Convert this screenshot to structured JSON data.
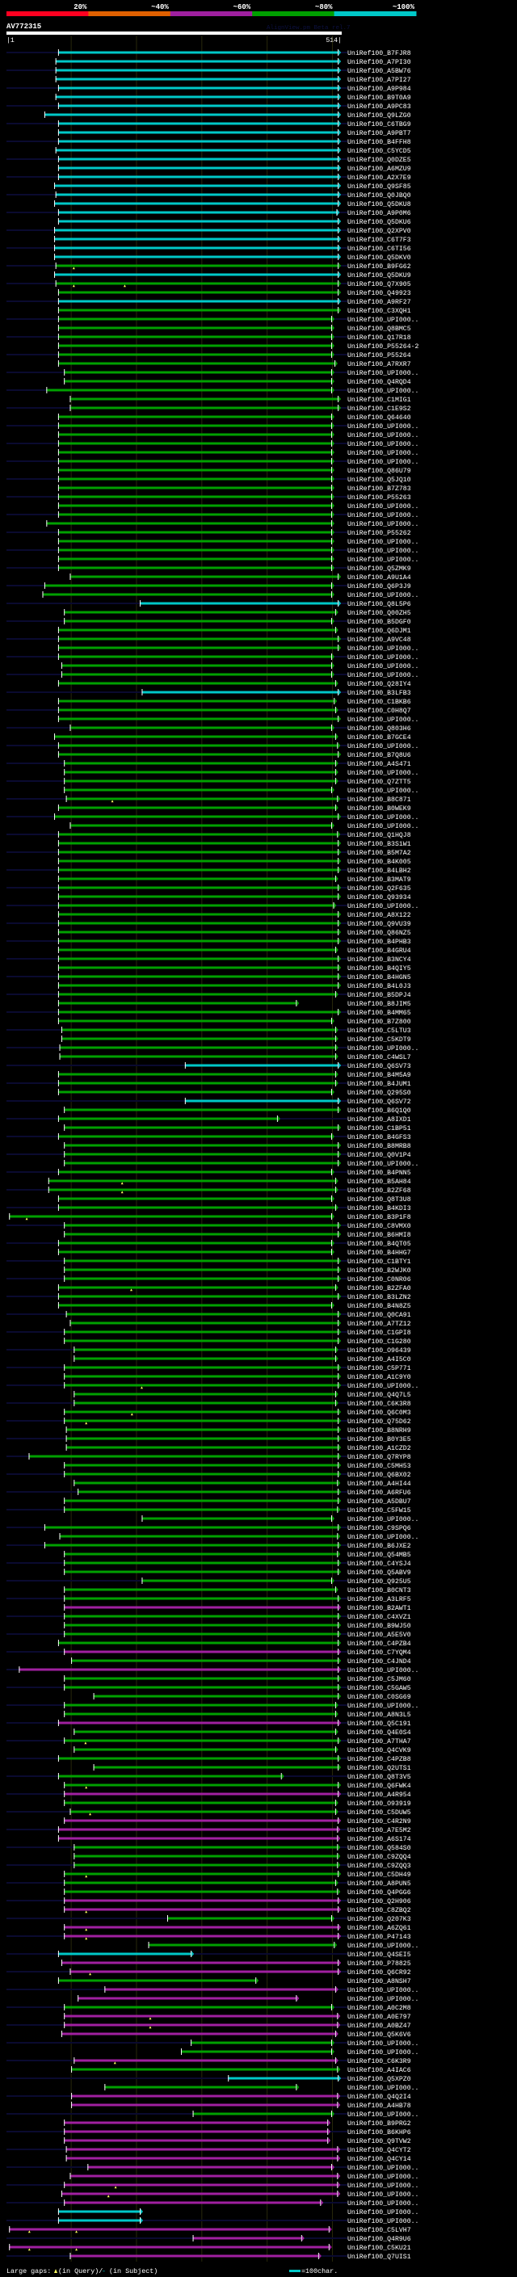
{
  "legend": {
    "segments": [
      {
        "label": "20%",
        "color": "#ff0020"
      },
      {
        "label": "~40%",
        "color": "#e06000"
      },
      {
        "label": "~60%",
        "color": "#a020a0"
      },
      {
        "label": "~80%",
        "color": "#00a000"
      },
      {
        "label": "~100%",
        "color": "#00c8c8"
      }
    ]
  },
  "query": {
    "name": "AV772315",
    "watermark": "AlignView.pm Beta rel.7",
    "start_label": "|1",
    "end_label": "514|",
    "length": 514,
    "grid_every": 100
  },
  "colors": {
    "c": "#00c8c8",
    "g": "#00a000",
    "m": "#a020a0",
    "row_line": "#0a0a30",
    "grid": "#3a3a10",
    "query_gap": "#ffff60"
  },
  "footer": {
    "large_gaps_label": "Large gaps:",
    "query_gap_text": "(in Query)/",
    "subject_gap_glyph": "-",
    "subject_gap_text": "(in Subject)",
    "scale_text": "=100char."
  },
  "hits": [
    [
      "UniRef100_B7FJR8",
      "c",
      80,
      508
    ],
    [
      "UniRef100_A7PI30",
      "c",
      76,
      508
    ],
    [
      "UniRef100_A5BW76",
      "c",
      76,
      508
    ],
    [
      "UniRef100_A7PI27",
      "c",
      76,
      508
    ],
    [
      "UniRef100_A9P984",
      "c",
      80,
      508
    ],
    [
      "UniRef100_B9T0A9",
      "c",
      76,
      508
    ],
    [
      "UniRef100_A9PC83",
      "c",
      80,
      508
    ],
    [
      "UniRef100_Q9LZG0",
      "c",
      59,
      508
    ],
    [
      "UniRef100_C6TBG9",
      "c",
      80,
      508
    ],
    [
      "UniRef100_A9PBT7",
      "c",
      80,
      508
    ],
    [
      "UniRef100_B4FFH8",
      "c",
      80,
      508
    ],
    [
      "UniRef100_C5YCD5",
      "c",
      76,
      508
    ],
    [
      "UniRef100_Q0DZE5",
      "c",
      80,
      508
    ],
    [
      "UniRef100_A6MZU9",
      "c",
      80,
      508
    ],
    [
      "UniRef100_A2X7E9",
      "c",
      80,
      508
    ],
    [
      "UniRef100_Q9SF85",
      "c",
      74,
      508
    ],
    [
      "UniRef100_Q0JBQ0",
      "c",
      76,
      508
    ],
    [
      "UniRef100_Q5DKU8",
      "c",
      74,
      508
    ],
    [
      "UniRef100_A9P0M6",
      "c",
      80,
      506
    ],
    [
      "UniRef100_Q5DKU6",
      "c",
      80,
      508
    ],
    [
      "UniRef100_Q2XPV0",
      "c",
      74,
      508
    ],
    [
      "UniRef100_C6T7F3",
      "c",
      74,
      508
    ],
    [
      "UniRef100_C6TI56",
      "c",
      74,
      508
    ],
    [
      "UniRef100_Q5DKV0",
      "c",
      74,
      508
    ],
    [
      "UniRef100_B9FG62",
      "g",
      76,
      508,
      [
        104
      ]
    ],
    [
      "UniRef100_Q5DKU9",
      "c",
      74,
      508
    ],
    [
      "UniRef100_Q7X905",
      "g",
      76,
      508,
      [
        104,
        182
      ]
    ],
    [
      "UniRef100_Q49923",
      "g",
      80,
      508
    ],
    [
      "UniRef100_A9RF27",
      "c",
      80,
      508
    ],
    [
      "UniRef100_C3XQH1",
      "g",
      80,
      508
    ],
    [
      "UniRef100_UPI000..",
      "g",
      80,
      498
    ],
    [
      "UniRef100_Q8BMC5",
      "g",
      80,
      498
    ],
    [
      "UniRef100_Q17R18",
      "g",
      80,
      498
    ],
    [
      "UniRef100_P55264-2",
      "g",
      80,
      498
    ],
    [
      "UniRef100_P55264",
      "g",
      80,
      498
    ],
    [
      "UniRef100_A7RXR7",
      "g",
      80,
      503
    ],
    [
      "UniRef100_UPI000..",
      "g",
      89,
      498
    ],
    [
      "UniRef100_Q4RQD4",
      "g",
      89,
      498
    ],
    [
      "UniRef100_UPI000..",
      "g",
      62,
      498
    ],
    [
      "UniRef100_C1MIG1",
      "g",
      98,
      508
    ],
    [
      "UniRef100_C1E9S2",
      "g",
      98,
      508
    ],
    [
      "UniRef100_Q64640",
      "g",
      80,
      498
    ],
    [
      "UniRef100_UPI000..",
      "g",
      80,
      498
    ],
    [
      "UniRef100_UPI000..",
      "g",
      80,
      498
    ],
    [
      "UniRef100_UPI000..",
      "g",
      80,
      498
    ],
    [
      "UniRef100_UPI000..",
      "g",
      80,
      498
    ],
    [
      "UniRef100_UPI000..",
      "g",
      80,
      498
    ],
    [
      "UniRef100_Q86U79",
      "g",
      80,
      498
    ],
    [
      "UniRef100_Q5JQ10",
      "g",
      80,
      498
    ],
    [
      "UniRef100_B7Z783",
      "g",
      80,
      498
    ],
    [
      "UniRef100_P55263",
      "g",
      80,
      498
    ],
    [
      "UniRef100_UPI000..",
      "g",
      80,
      498
    ],
    [
      "UniRef100_UPI000..",
      "g",
      80,
      498
    ],
    [
      "UniRef100_UPI000..",
      "g",
      62,
      498
    ],
    [
      "UniRef100_P55262",
      "g",
      80,
      498
    ],
    [
      "UniRef100_UPI000..",
      "g",
      80,
      498
    ],
    [
      "UniRef100_UPI000..",
      "g",
      80,
      498
    ],
    [
      "UniRef100_UPI000..",
      "g",
      80,
      498
    ],
    [
      "UniRef100_Q5ZMK9",
      "g",
      80,
      498
    ],
    [
      "UniRef100_A9U1A4",
      "g",
      98,
      508
    ],
    [
      "UniRef100_Q6P3J9",
      "g",
      59,
      498
    ],
    [
      "UniRef100_UPI000..",
      "g",
      56,
      498
    ],
    [
      "UniRef100_Q8L5P6",
      "c",
      205,
      508
    ],
    [
      "UniRef100_Q00ZH5",
      "g",
      89,
      504
    ],
    [
      "UniRef100_B5DGF0",
      "g",
      89,
      498
    ],
    [
      "UniRef100_Q6DJM1",
      "g",
      80,
      504
    ],
    [
      "UniRef100_A9VC48",
      "g",
      80,
      508
    ],
    [
      "UniRef100_UPI000..",
      "g",
      80,
      508
    ],
    [
      "UniRef100_UPI000..",
      "g",
      80,
      498
    ],
    [
      "UniRef100_UPI000..",
      "g",
      85,
      498
    ],
    [
      "UniRef100_UPI000..",
      "g",
      85,
      498
    ],
    [
      "UniRef100_Q28IY4",
      "g",
      80,
      504
    ],
    [
      "UniRef100_B3LFB3",
      "c",
      208,
      508
    ],
    [
      "UniRef100_C1BKB6",
      "g",
      80,
      502
    ],
    [
      "UniRef100_C0H8Q7",
      "g",
      80,
      504
    ],
    [
      "UniRef100_UPI000..",
      "g",
      80,
      508
    ],
    [
      "UniRef100_Q803H6",
      "g",
      98,
      498
    ],
    [
      "UniRef100_B7GCE4",
      "g",
      74,
      504
    ],
    [
      "UniRef100_UPI000..",
      "g",
      80,
      507
    ],
    [
      "UniRef100_B7Q8U6",
      "g",
      80,
      508
    ],
    [
      "UniRef100_A4S471",
      "g",
      89,
      504
    ],
    [
      "UniRef100_UPI000..",
      "g",
      89,
      504
    ],
    [
      "UniRef100_Q7ZTT5",
      "g",
      89,
      504
    ],
    [
      "UniRef100_UPI000..",
      "g",
      89,
      498
    ],
    [
      "UniRef100_B8C871",
      "g",
      92,
      507,
      [
        163
      ]
    ],
    [
      "UniRef100_B0WEK9",
      "g",
      80,
      504
    ],
    [
      "UniRef100_UPI000..",
      "g",
      74,
      508
    ],
    [
      "UniRef100_UPI000..",
      "g",
      98,
      498
    ],
    [
      "UniRef100_Q1HQJ8",
      "g",
      80,
      507
    ],
    [
      "UniRef100_B3S1W1",
      "g",
      80,
      508
    ],
    [
      "UniRef100_B5M7A2",
      "g",
      80,
      508
    ],
    [
      "UniRef100_B4K005",
      "g",
      80,
      508
    ],
    [
      "UniRef100_B4LBH2",
      "g",
      80,
      508
    ],
    [
      "UniRef100_B3MAT9",
      "g",
      80,
      504
    ],
    [
      "UniRef100_Q2F635",
      "g",
      80,
      508
    ],
    [
      "UniRef100_Q93934",
      "g",
      80,
      508
    ],
    [
      "UniRef100_UPI000..",
      "g",
      80,
      501
    ],
    [
      "UniRef100_A8X122",
      "g",
      80,
      508
    ],
    [
      "UniRef100_Q9VU39",
      "g",
      80,
      508
    ],
    [
      "UniRef100_Q86NZ5",
      "g",
      80,
      508
    ],
    [
      "UniRef100_B4PHB3",
      "g",
      80,
      508
    ],
    [
      "UniRef100_B4GRU4",
      "g",
      80,
      504
    ],
    [
      "UniRef100_B3NCY4",
      "g",
      80,
      508
    ],
    [
      "UniRef100_B4QIY5",
      "g",
      80,
      508
    ],
    [
      "UniRef100_B4HGN5",
      "g",
      80,
      508
    ],
    [
      "UniRef100_B4L0J3",
      "g",
      80,
      508
    ],
    [
      "UniRef100_B5DPJ4",
      "g",
      80,
      504
    ],
    [
      "UniRef100_B8JIM5",
      "g",
      80,
      444
    ],
    [
      "UniRef100_B4MM65",
      "g",
      80,
      508
    ],
    [
      "UniRef100_B7Z800",
      "g",
      80,
      498
    ],
    [
      "UniRef100_C5LTU3",
      "g",
      85,
      504
    ],
    [
      "UniRef100_C5KDT9",
      "g",
      85,
      504
    ],
    [
      "UniRef100_UPI000..",
      "g",
      82,
      504
    ],
    [
      "UniRef100_C4WSL7",
      "g",
      82,
      504
    ],
    [
      "UniRef100_Q6SV73",
      "c",
      274,
      508
    ],
    [
      "UniRef100_B4M5A9",
      "g",
      80,
      504
    ],
    [
      "UniRef100_B4JUM1",
      "g",
      80,
      504
    ],
    [
      "UniRef100_Q295S0",
      "g",
      80,
      498
    ],
    [
      "UniRef100_Q6SV72",
      "c",
      274,
      508
    ],
    [
      "UniRef100_B6Q1Q0",
      "g",
      89,
      508
    ],
    [
      "UniRef100_A8IXD1",
      "g",
      80,
      415
    ],
    [
      "UniRef100_C1BP51",
      "g",
      89,
      508
    ],
    [
      "UniRef100_B4GFS3",
      "g",
      80,
      498
    ],
    [
      "UniRef100_B8MRB8",
      "g",
      89,
      508
    ],
    [
      "UniRef100_Q0V1P4",
      "g",
      89,
      508
    ],
    [
      "UniRef100_UPI000..",
      "g",
      89,
      508
    ],
    [
      "UniRef100_B4PNN5",
      "g",
      80,
      498
    ],
    [
      "UniRef100_B5AH84",
      "g",
      65,
      504,
      [
        178
      ]
    ],
    [
      "UniRef100_B2ZF68",
      "g",
      65,
      504,
      [
        178
      ]
    ],
    [
      "UniRef100_Q8T3U8",
      "g",
      80,
      498
    ],
    [
      "UniRef100_B4KDI3",
      "g",
      80,
      504
    ],
    [
      "UniRef100_B3P1F8",
      "g",
      5,
      498,
      [
        32
      ]
    ],
    [
      "UniRef100_C8VMX0",
      "g",
      89,
      508
    ],
    [
      "UniRef100_B6HMI8",
      "g",
      89,
      508
    ],
    [
      "UniRef100_B4QT05",
      "g",
      80,
      498
    ],
    [
      "UniRef100_B4HHG7",
      "g",
      80,
      498
    ],
    [
      "UniRef100_C1BTY1",
      "g",
      89,
      508
    ],
    [
      "UniRef100_B2WJK0",
      "g",
      89,
      508
    ],
    [
      "UniRef100_C0NR06",
      "g",
      89,
      508
    ],
    [
      "UniRef100_B2ZFA0",
      "g",
      80,
      504,
      [
        192
      ]
    ],
    [
      "UniRef100_B3LZN2",
      "g",
      80,
      508
    ],
    [
      "UniRef100_B4N8Z5",
      "g",
      80,
      498
    ],
    [
      "UniRef100_Q0CA91",
      "g",
      92,
      508
    ],
    [
      "UniRef100_A7TZ12",
      "g",
      98,
      508
    ],
    [
      "UniRef100_C1GPI8",
      "g",
      89,
      508
    ],
    [
      "UniRef100_C1G280",
      "g",
      89,
      508
    ],
    [
      "UniRef100_O96439",
      "g",
      104,
      504
    ],
    [
      "UniRef100_A4I5C0",
      "g",
      104,
      504
    ],
    [
      "UniRef100_C5P771",
      "g",
      89,
      508
    ],
    [
      "UniRef100_A1C9Y0",
      "g",
      89,
      508
    ],
    [
      "UniRef100_UPI000..",
      "g",
      89,
      508,
      [
        208
      ]
    ],
    [
      "UniRef100_Q4Q7L5",
      "g",
      104,
      504
    ],
    [
      "UniRef100_C6K3R8",
      "g",
      104,
      504
    ],
    [
      "UniRef100_Q6C0M3",
      "g",
      89,
      508,
      [
        193
      ]
    ],
    [
      "UniRef100_Q75D62",
      "g",
      89,
      508,
      [
        123
      ]
    ],
    [
      "UniRef100_B8NRH9",
      "g",
      92,
      508
    ],
    [
      "UniRef100_B0Y3E5",
      "g",
      92,
      508
    ],
    [
      "UniRef100_A1CZD2",
      "g",
      92,
      508
    ],
    [
      "UniRef100_Q7RYP8",
      "g",
      35,
      508
    ],
    [
      "UniRef100_C5MH53",
      "g",
      89,
      508
    ],
    [
      "UniRef100_Q6BX02",
      "g",
      89,
      508
    ],
    [
      "UniRef100_A4HI44",
      "g",
      104,
      507
    ],
    [
      "UniRef100_A6RFU6",
      "g",
      110,
      508
    ],
    [
      "UniRef100_A5DBU7",
      "g",
      89,
      508
    ],
    [
      "UniRef100_C5FW15",
      "g",
      89,
      507
    ],
    [
      "UniRef100_UPI000..",
      "g",
      208,
      498
    ],
    [
      "UniRef100_C9SPQ6",
      "g",
      59,
      508
    ],
    [
      "UniRef100_UPI000..",
      "g",
      82,
      507
    ],
    [
      "UniRef100_B6JXE2",
      "g",
      59,
      508
    ],
    [
      "UniRef100_Q54MB5",
      "g",
      89,
      507
    ],
    [
      "UniRef100_C4YSJ4",
      "g",
      89,
      508
    ],
    [
      "UniRef100_Q5ABV9",
      "g",
      89,
      508
    ],
    [
      "UniRef100_Q925U5",
      "g",
      208,
      498
    ],
    [
      "UniRef100_B0CNT3",
      "g",
      89,
      504
    ],
    [
      "UniRef100_A3LRF5",
      "g",
      89,
      508
    ],
    [
      "UniRef100_B2AWT1",
      "m",
      89,
      508
    ],
    [
      "UniRef100_C4XVZ1",
      "g",
      89,
      508
    ],
    [
      "UniRef100_B9WJ50",
      "g",
      89,
      508
    ],
    [
      "UniRef100_A5E5V0",
      "g",
      89,
      508
    ],
    [
      "UniRef100_C4PZB4",
      "g",
      80,
      508
    ],
    [
      "UniRef100_C7YQM4",
      "m",
      89,
      508
    ],
    [
      "UniRef100_C4JND4",
      "g",
      100,
      508
    ],
    [
      "UniRef100_UPI000..",
      "m",
      20,
      508
    ],
    [
      "UniRef100_C5JM60",
      "g",
      89,
      508
    ],
    [
      "UniRef100_C5GAW5",
      "g",
      89,
      508
    ],
    [
      "UniRef100_C0SG69",
      "g",
      134,
      508
    ],
    [
      "UniRef100_UPI000..",
      "g",
      89,
      504
    ],
    [
      "UniRef100_A8N3L5",
      "g",
      89,
      504
    ],
    [
      "UniRef100_Q5C191",
      "m",
      80,
      508
    ],
    [
      "UniRef100_Q4E0S4",
      "g",
      104,
      504
    ],
    [
      "UniRef100_A7THA7",
      "g",
      89,
      508,
      [
        122
      ]
    ],
    [
      "UniRef100_Q4CVK9",
      "g",
      104,
      504
    ],
    [
      "UniRef100_C4PZB8",
      "g",
      80,
      508
    ],
    [
      "UniRef100_Q2UTS1",
      "g",
      134,
      508
    ],
    [
      "UniRef100_Q8T3V5",
      "g",
      80,
      421
    ],
    [
      "UniRef100_Q6FWK4",
      "g",
      89,
      508,
      [
        123
      ]
    ],
    [
      "UniRef100_A4R954",
      "m",
      89,
      508
    ],
    [
      "UniRef100_O93919",
      "g",
      89,
      504
    ],
    [
      "UniRef100_C5DUW5",
      "g",
      98,
      504,
      [
        129
      ]
    ],
    [
      "UniRef100_C4R2N9",
      "m",
      89,
      508
    ],
    [
      "UniRef100_A7E5M2",
      "m",
      80,
      507
    ],
    [
      "UniRef100_A6S174",
      "m",
      80,
      507
    ],
    [
      "UniRef100_Q584S0",
      "g",
      104,
      507
    ],
    [
      "UniRef100_C9ZQQ4",
      "g",
      104,
      507
    ],
    [
      "UniRef100_C9ZQQ3",
      "g",
      104,
      507
    ],
    [
      "UniRef100_C5DH49",
      "g",
      89,
      508,
      [
        123
      ]
    ],
    [
      "UniRef100_A8PUN5",
      "g",
      89,
      504
    ],
    [
      "UniRef100_Q4PGG6",
      "g",
      89,
      507
    ],
    [
      "UniRef100_Q2H906",
      "m",
      89,
      508
    ],
    [
      "UniRef100_C8ZBQ2",
      "m",
      89,
      508,
      [
        123
      ]
    ],
    [
      "UniRef100_Q207K3",
      "g",
      247,
      498
    ],
    [
      "UniRef100_A6ZQ61",
      "m",
      89,
      508,
      [
        123
      ]
    ],
    [
      "UniRef100_P47143",
      "m",
      89,
      508,
      [
        123
      ]
    ],
    [
      "UniRef100_UPI000..",
      "g",
      218,
      502
    ],
    [
      "UniRef100_Q4SEI5",
      "c",
      80,
      283
    ],
    [
      "UniRef100_P78825",
      "m",
      85,
      508
    ],
    [
      "UniRef100_Q6CR92",
      "m",
      98,
      508,
      [
        129
      ]
    ],
    [
      "UniRef100_A8NSH7",
      "g",
      80,
      382
    ],
    [
      "UniRef100_UPI000..",
      "m",
      151,
      504
    ],
    [
      "UniRef100_UPI000..",
      "m",
      110,
      444
    ],
    [
      "UniRef100_A0C2M8",
      "g",
      89,
      498
    ],
    [
      "UniRef100_A0E797",
      "m",
      89,
      507,
      [
        221
      ]
    ],
    [
      "UniRef100_A0BZ47",
      "m",
      89,
      507,
      [
        221
      ]
    ],
    [
      "UniRef100_Q5K6V6",
      "m",
      85,
      504
    ],
    [
      "UniRef100_UPI000..",
      "g",
      283,
      498
    ],
    [
      "UniRef100_UPI000..",
      "g",
      268,
      498
    ],
    [
      "UniRef100_C6K3R9",
      "m",
      104,
      504,
      [
        167
      ]
    ],
    [
      "UniRef100_A4IAC6",
      "g",
      100,
      507
    ],
    [
      "UniRef100_Q5XPZ0",
      "c",
      340,
      508
    ],
    [
      "UniRef100_UPI000..",
      "g",
      151,
      444
    ],
    [
      "UniRef100_Q4Q2I4",
      "m",
      100,
      507
    ],
    [
      "UniRef100_A4HB78",
      "m",
      100,
      507
    ],
    [
      "UniRef100_UPI000..",
      "g",
      286,
      498
    ],
    [
      "UniRef100_B9PRG2",
      "m",
      89,
      492
    ],
    [
      "UniRef100_B6KHP6",
      "m",
      89,
      492
    ],
    [
      "UniRef100_Q9TVW2",
      "m",
      89,
      492
    ],
    [
      "UniRef100_Q4CYT2",
      "m",
      92,
      507
    ],
    [
      "UniRef100_Q4CY14",
      "m",
      92,
      507
    ],
    [
      "UniRef100_UPI000..",
      "m",
      125,
      498
    ],
    [
      "UniRef100_UPI000..",
      "m",
      98,
      507
    ],
    [
      "UniRef100_UPI000..",
      "m",
      89,
      507,
      [
        168
      ]
    ],
    [
      "UniRef100_UPI000..",
      "m",
      85,
      507,
      [
        157
      ]
    ],
    [
      "UniRef100_UPI000..",
      "m",
      89,
      481
    ],
    [
      "UniRef100_UPI000..",
      "c",
      80,
      205
    ],
    [
      "UniRef100_UPI000..",
      "c",
      80,
      205
    ],
    [
      "UniRef100_C5LVH7",
      "m",
      5,
      494,
      [
        36,
        108
      ]
    ],
    [
      "UniRef100_Q4R9U6",
      "m",
      286,
      452
    ],
    [
      "UniRef100_C5KU21",
      "m",
      5,
      494,
      [
        36,
        108
      ]
    ],
    [
      "UniRef100_Q7UIS1",
      "m",
      98,
      478
    ]
  ]
}
